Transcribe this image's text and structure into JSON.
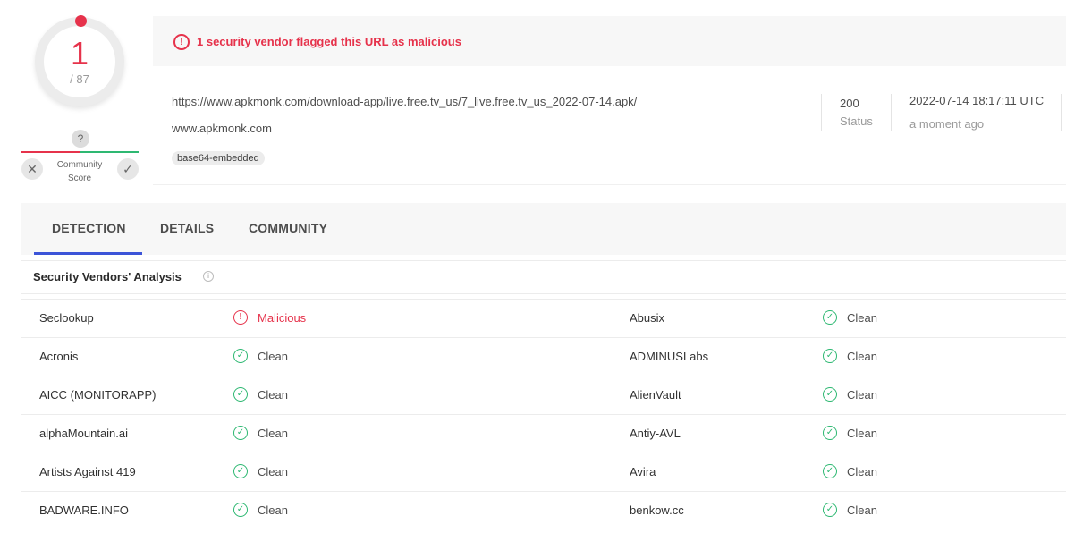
{
  "score": {
    "detections": "1",
    "total": "/ 87",
    "community_q": "?",
    "community_label": "Community Score",
    "vote_down": "✕",
    "vote_up": "✓"
  },
  "alert": {
    "icon": "!",
    "text": "1 security vendor flagged this URL as malicious"
  },
  "url_info": {
    "url": "https://www.apkmonk.com/download-app/live.free.tv_us/7_live.free.tv_us_2022-07-14.apk/",
    "domain": "www.apkmonk.com",
    "tag": "base64-embedded",
    "status_code": "200",
    "status_label": "Status",
    "date": "2022-07-14 18:17:11 UTC",
    "date_relative": "a moment ago"
  },
  "tabs": [
    {
      "label": "DETECTION",
      "active": true
    },
    {
      "label": "DETAILS",
      "active": false
    },
    {
      "label": "COMMUNITY",
      "active": false
    }
  ],
  "section": {
    "title": "Security Vendors' Analysis",
    "info_icon": "i"
  },
  "vendors": [
    {
      "left": {
        "name": "Seclookup",
        "result": "Malicious",
        "status": "malicious"
      },
      "right": {
        "name": "Abusix",
        "result": "Clean",
        "status": "clean"
      }
    },
    {
      "left": {
        "name": "Acronis",
        "result": "Clean",
        "status": "clean"
      },
      "right": {
        "name": "ADMINUSLabs",
        "result": "Clean",
        "status": "clean"
      }
    },
    {
      "left": {
        "name": "AICC (MONITORAPP)",
        "result": "Clean",
        "status": "clean"
      },
      "right": {
        "name": "AlienVault",
        "result": "Clean",
        "status": "clean"
      }
    },
    {
      "left": {
        "name": "alphaMountain.ai",
        "result": "Clean",
        "status": "clean"
      },
      "right": {
        "name": "Antiy-AVL",
        "result": "Clean",
        "status": "clean"
      }
    },
    {
      "left": {
        "name": "Artists Against 419",
        "result": "Clean",
        "status": "clean"
      },
      "right": {
        "name": "Avira",
        "result": "Clean",
        "status": "clean"
      }
    },
    {
      "left": {
        "name": "BADWARE.INFO",
        "result": "Clean",
        "status": "clean"
      },
      "right": {
        "name": "benkow.cc",
        "result": "Clean",
        "status": "clean"
      }
    }
  ],
  "colors": {
    "malicious": "#e6324b",
    "clean": "#2eb872",
    "accent": "#3c54d8"
  },
  "icons": {
    "malicious": "alert-circle-icon",
    "clean": "check-circle-icon"
  }
}
